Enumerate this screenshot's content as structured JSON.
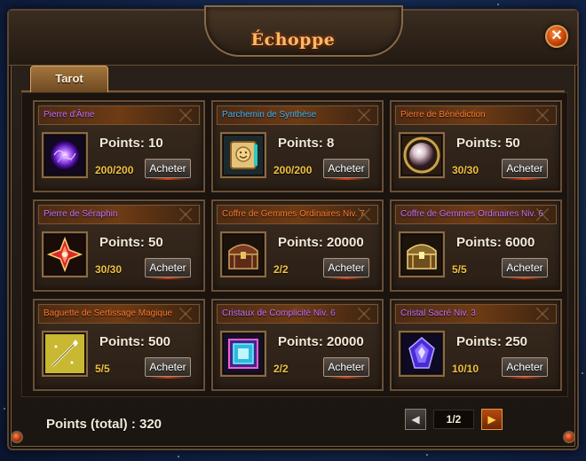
{
  "window": {
    "title": "Échoppe",
    "close_symbol": "✕"
  },
  "tabs": [
    {
      "label": "Tarot",
      "active": true
    }
  ],
  "colors": {
    "name_purple": "#c470ff",
    "name_blue": "#3fb6ff",
    "name_orange": "#ff7a30",
    "stock_yellow": "#f0c040",
    "title_orange": "#ffb868"
  },
  "items": [
    {
      "name": "Pierre d'Âme",
      "name_color": "#c470ff",
      "points": "Points: 10",
      "stock": "200/200",
      "buy_label": "Acheter",
      "icon": "soul-stone-icon"
    },
    {
      "name": "Parchemin de Synthèse",
      "name_color": "#3fb6ff",
      "points": "Points: 8",
      "stock": "200/200",
      "buy_label": "Acheter",
      "icon": "scroll-icon"
    },
    {
      "name": "Pierre de Bénédiction",
      "name_color": "#ff7a30",
      "points": "Points: 50",
      "stock": "30/30",
      "buy_label": "Acheter",
      "icon": "pearl-icon"
    },
    {
      "name": "Pierre de Séraphin",
      "name_color": "#c470ff",
      "points": "Points: 50",
      "stock": "30/30",
      "buy_label": "Acheter",
      "icon": "seraph-gem-icon"
    },
    {
      "name": "Coffre de Gemmes Ordinaires Niv. 7",
      "name_color": "#ff7a30",
      "points": "Points: 20000",
      "stock": "2/2",
      "buy_label": "Acheter",
      "icon": "chest-icon"
    },
    {
      "name": "Coffre de Gemmes Ordinaires Niv. 6",
      "name_color": "#c470ff",
      "points": "Points: 6000",
      "stock": "5/5",
      "buy_label": "Acheter",
      "icon": "chest-gold-icon"
    },
    {
      "name": "Baguette de Sertissage Magique",
      "name_color": "#ff7a30",
      "points": "Points: 500",
      "stock": "5/5",
      "buy_label": "Acheter",
      "icon": "wand-icon"
    },
    {
      "name": "Cristaux de Complicité Niv. 6",
      "name_color": "#c470ff",
      "points": "Points: 20000",
      "stock": "2/2",
      "buy_label": "Acheter",
      "icon": "crystal-square-icon"
    },
    {
      "name": "Cristal Sacré Niv. 3",
      "name_color": "#c470ff",
      "points": "Points: 250",
      "stock": "10/10",
      "buy_label": "Acheter",
      "icon": "sacred-crystal-icon"
    }
  ],
  "footer": {
    "total_points": "Points (total) : 320"
  },
  "pagination": {
    "label": "1/2",
    "prev_symbol": "◀",
    "next_symbol": "▶",
    "current_page": 1,
    "total_pages": 2
  }
}
